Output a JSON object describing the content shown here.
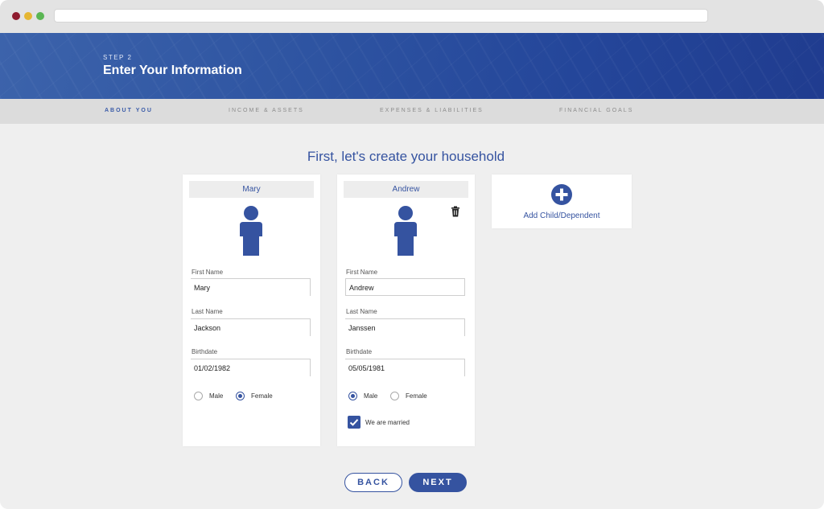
{
  "header": {
    "step": "STEP 2",
    "title": "Enter Your Information"
  },
  "tabs": [
    {
      "label": "ABOUT YOU",
      "active": true
    },
    {
      "label": "INCOME & ASSETS",
      "active": false
    },
    {
      "label": "EXPENSES & LIABILITIES",
      "active": false
    },
    {
      "label": "FINANCIAL GOALS",
      "active": false
    }
  ],
  "heading": "First, let's create your household",
  "cards": [
    {
      "name": "Mary",
      "first_name_label": "First Name",
      "first_name": "Mary",
      "last_name_label": "Last Name",
      "last_name": "Jackson",
      "birthdate_label": "Birthdate",
      "birthdate": "01/02/1982",
      "male_label": "Male",
      "female_label": "Female",
      "gender": "female"
    },
    {
      "name": "Andrew",
      "first_name_label": "First Name",
      "first_name": "Andrew",
      "last_name_label": "Last Name",
      "last_name": "Janssen",
      "birthdate_label": "Birthdate",
      "birthdate": "05/05/1981",
      "male_label": "Male",
      "female_label": "Female",
      "gender": "male",
      "married_label": "We are married",
      "married": true
    }
  ],
  "add_dependent": {
    "label": "Add Child/Dependent"
  },
  "buttons": {
    "back": "BACK",
    "next": "NEXT"
  },
  "colors": {
    "primary": "#3553a0",
    "background": "#efefef",
    "tabs_bar": "#dcdcdc"
  },
  "icons": [
    "trash-icon",
    "person-icon",
    "plus-circle-icon",
    "checkmark-icon"
  ]
}
